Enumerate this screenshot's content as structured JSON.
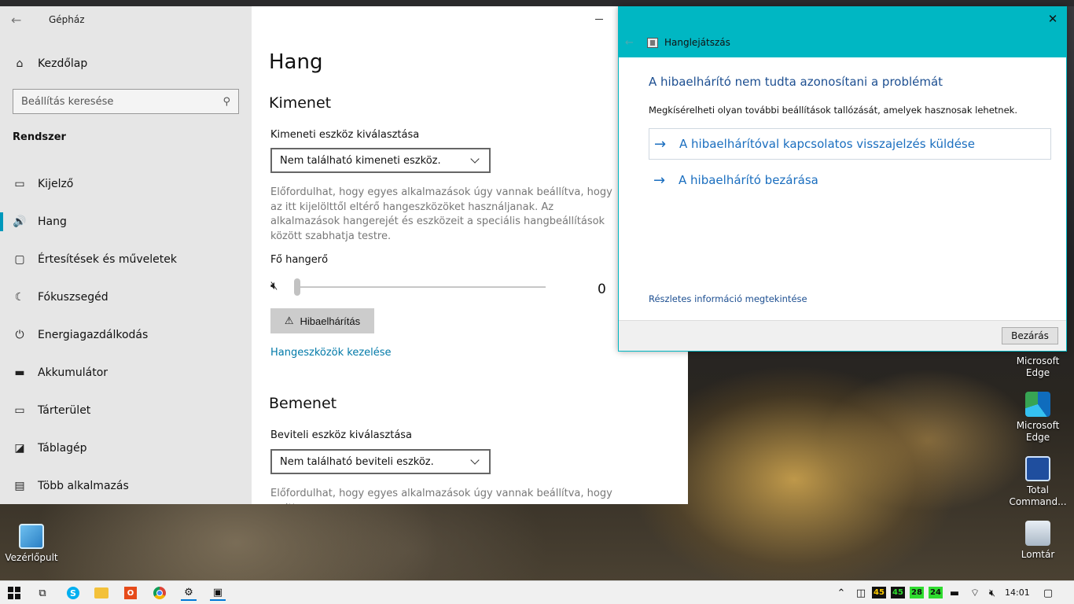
{
  "settings": {
    "window_title": "Gépház",
    "home_label": "Kezdőlap",
    "search_placeholder": "Beállítás keresése",
    "section": "Rendszer",
    "nav": [
      {
        "label": "Kijelző",
        "icon": "monitor-icon"
      },
      {
        "label": "Hang",
        "icon": "speaker-icon",
        "active": true
      },
      {
        "label": "Értesítések és műveletek",
        "icon": "notification-icon"
      },
      {
        "label": "Fókuszsegéd",
        "icon": "moon-icon"
      },
      {
        "label": "Energiagazdálkodás",
        "icon": "power-icon"
      },
      {
        "label": "Akkumulátor",
        "icon": "battery-icon"
      },
      {
        "label": "Tárterület",
        "icon": "storage-icon"
      },
      {
        "label": "Táblagép",
        "icon": "tablet-icon"
      },
      {
        "label": "Több alkalmazás",
        "icon": "multitask-icon"
      }
    ],
    "page_title": "Hang",
    "output": {
      "heading": "Kimenet",
      "device_label": "Kimeneti eszköz kiválasztása",
      "device_value": "Nem található kimeneti eszköz.",
      "description": "Előfordulhat, hogy egyes alkalmazások úgy vannak beállítva, hogy az itt kijelölttől eltérő hangeszközöket használjanak. Az alkalmazások hangerejét és eszközeit a speciális hangbeállítások között szabhatja testre.",
      "volume_label": "Fő hangerő",
      "volume_value": "0",
      "troubleshoot_label": "Hibaelhárítás",
      "manage_link": "Hangeszközök kezelése"
    },
    "input": {
      "heading": "Bemenet",
      "device_label": "Beviteli eszköz kiválasztása",
      "device_value": "Nem található beviteli eszköz.",
      "description": "Előfordulhat, hogy egyes alkalmazások úgy vannak beállítva, hogy az itt"
    }
  },
  "troubleshooter": {
    "app_title": "Hanglejátszás",
    "heading": "A hibaelhárító nem tudta azonosítani a problémát",
    "subtext": "Megkísérelheti olyan további beállítások tallózását, amelyek hasznosak lehetnek.",
    "options": [
      "A hibaelhárítóval kapcsolatos visszajelzés küldése",
      "A hibaelhárító bezárása"
    ],
    "details_link": "Részletes információ megtekintése",
    "close_button": "Bezárás"
  },
  "desktop_icons": [
    {
      "label": "Microsoft Edge",
      "icon": "edge-icon"
    },
    {
      "label": "Microsoft Edge",
      "icon": "edge-icon"
    },
    {
      "label": "Total Command...",
      "icon": "total-commander-icon"
    },
    {
      "label": "Lomtár",
      "icon": "recycle-bin-icon"
    },
    {
      "label": "Vezérlőpult",
      "icon": "control-panel-icon"
    }
  ],
  "taskbar": {
    "tray_values": [
      "45",
      "45",
      "28",
      "24"
    ],
    "clock": "14:01"
  }
}
